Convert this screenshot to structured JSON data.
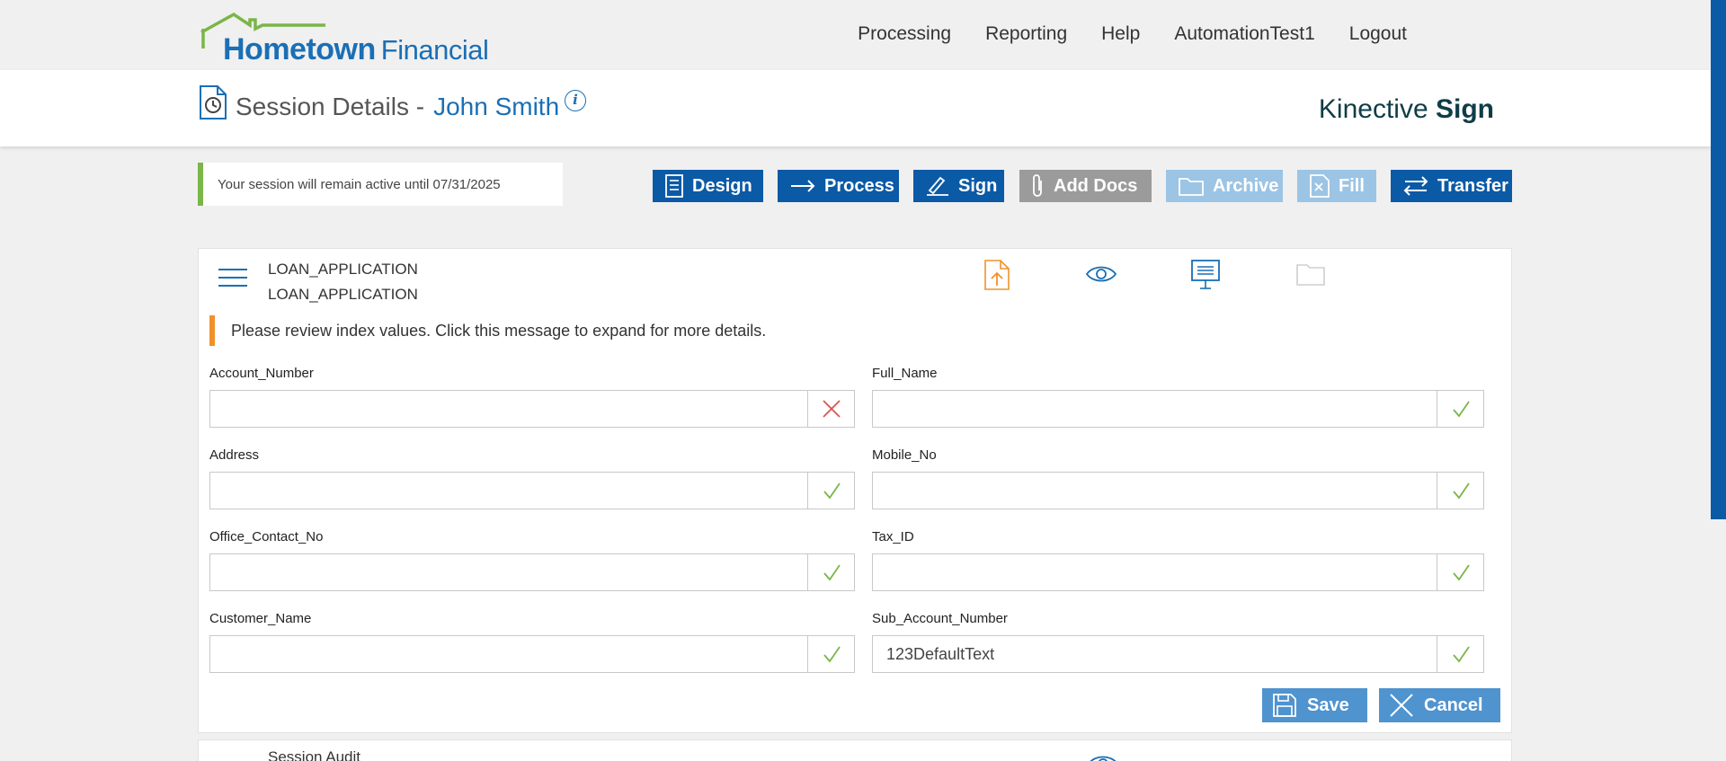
{
  "header": {
    "logo_main": "Hometown",
    "logo_sub": "Financial",
    "nav": [
      "Processing",
      "Reporting",
      "Help",
      "AutomationTest1",
      "Logout"
    ]
  },
  "session": {
    "title": "Session Details -",
    "customer": "John Smith",
    "brand_light": "Kinective",
    "brand_bold": "Sign",
    "notice": "Your session will remain active until 07/31/2025"
  },
  "actions": {
    "design": "Design",
    "process": "Process",
    "sign": "Sign",
    "add_docs": "Add Docs",
    "archive": "Archive",
    "fill": "Fill",
    "transfer": "Transfer"
  },
  "document": {
    "name_1": "LOAN_APPLICATION",
    "name_2": "LOAN_APPLICATION",
    "alert": "Please review index values. Click this message to expand for more details.",
    "fields": [
      {
        "label": "Account_Number",
        "value": "",
        "status": "invalid"
      },
      {
        "label": "Full_Name",
        "value": "",
        "status": "valid"
      },
      {
        "label": "Address",
        "value": "",
        "status": "valid"
      },
      {
        "label": "Mobile_No",
        "value": "",
        "status": "valid"
      },
      {
        "label": "Office_Contact_No",
        "value": "",
        "status": "valid"
      },
      {
        "label": "Tax_ID",
        "value": "",
        "status": "valid"
      },
      {
        "label": "Customer_Name",
        "value": "",
        "status": "valid"
      },
      {
        "label": "Sub_Account_Number",
        "value": "123DefaultText",
        "status": "valid"
      }
    ],
    "save": "Save",
    "cancel": "Cancel"
  },
  "audit": {
    "title": "Session Audit"
  },
  "colors": {
    "primary": "#0b5aa6",
    "disabled_light": "#9cc4e4",
    "disabled_gray": "#9b9b9b",
    "success": "#7ab648",
    "error": "#d9534f",
    "warning": "#f0922b"
  }
}
